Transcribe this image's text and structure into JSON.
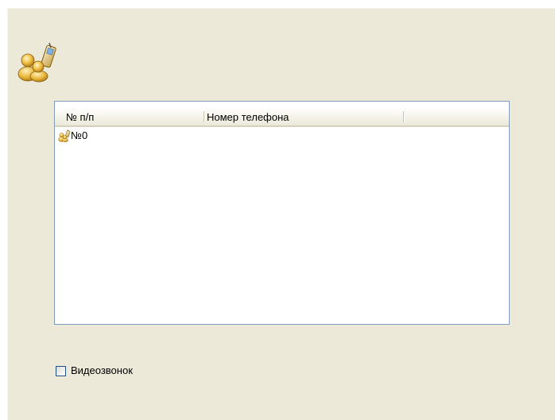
{
  "list": {
    "columns": [
      {
        "label": "№ п/п"
      },
      {
        "label": "Номер телефона"
      },
      {
        "label": ""
      }
    ],
    "rows": [
      {
        "icon": "contacts-phone-icon",
        "number": "№0",
        "phone": ""
      }
    ]
  },
  "options": {
    "video_call_label": "Видеозвонок",
    "video_call_checked": false
  },
  "colors": {
    "panel_background": "#ece9d8",
    "list_border": "#7f9db9",
    "checkbox_border": "#1c5180"
  }
}
